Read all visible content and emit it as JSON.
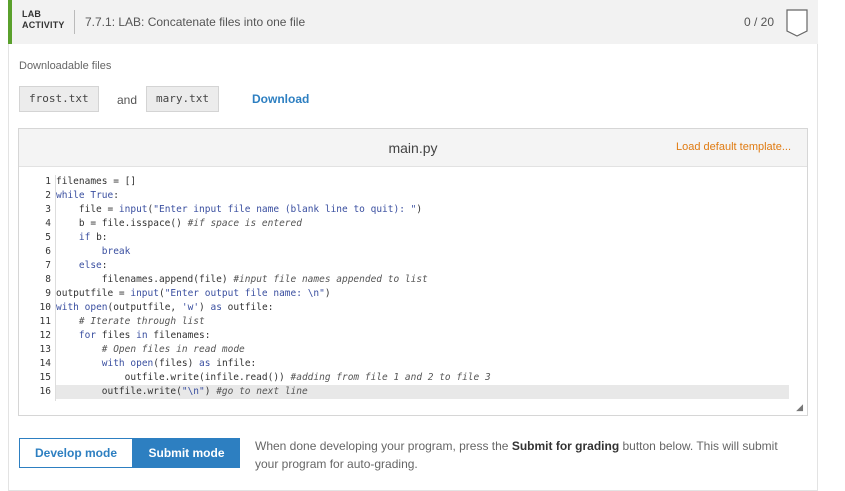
{
  "header": {
    "lab_label_line1": "LAB",
    "lab_label_line2": "ACTIVITY",
    "title": "7.7.1: LAB: Concatenate files into one file",
    "score": "0 / 20"
  },
  "downloads": {
    "label": "Downloadable files",
    "file1": "frost.txt",
    "and_text": "and",
    "file2": "mary.txt",
    "download_label": "Download"
  },
  "editor": {
    "filename": "main.py",
    "load_default": "Load default template...",
    "active_line": 16,
    "lines": [
      "filenames = []",
      "while True:",
      "    file = input(\"Enter input file name (blank line to quit): \")",
      "    b = file.isspace() #if space is entered",
      "    if b:",
      "        break",
      "    else:",
      "        filenames.append(file) #input file names appended to list",
      "outputfile = input(\"Enter output file name: \\n\")",
      "with open(outputfile, 'w') as outfile:",
      "    # Iterate through list",
      "    for files in filenames:",
      "        # Open files in read mode",
      "        with open(files) as infile:",
      "            outfile.write(infile.read()) #adding from file 1 and 2 to file 3",
      "        outfile.write(\"\\n\") #go to next line"
    ]
  },
  "modes": {
    "develop": "Develop mode",
    "submit": "Submit mode",
    "instructions_pre": "When done developing your program, press the ",
    "instructions_bold": "Submit for grading",
    "instructions_post": " button below. This will submit your program for auto-grading."
  },
  "colors": {
    "accent": "#2d7fc1",
    "activity_bar": "#5aa02c",
    "load_default": "#e07b12"
  }
}
